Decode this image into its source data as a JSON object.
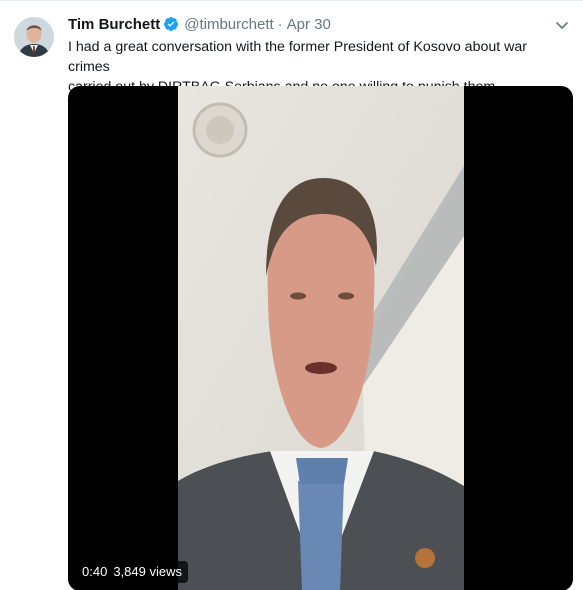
{
  "author": {
    "name": "Tim Burchett",
    "handle": "@timburchett",
    "separator": "·",
    "date": "Apr 30",
    "verified": true
  },
  "tweet": {
    "text_line1": "I had a great conversation with the former President of Kosovo about war crimes",
    "text_line2": "carried out by DIRTBAG Serbians and no one willing to punish them."
  },
  "video": {
    "duration": "0:40",
    "views": "3,849 views"
  },
  "colors": {
    "verified_blue": "#1da1f2",
    "secondary_text": "#657786"
  }
}
